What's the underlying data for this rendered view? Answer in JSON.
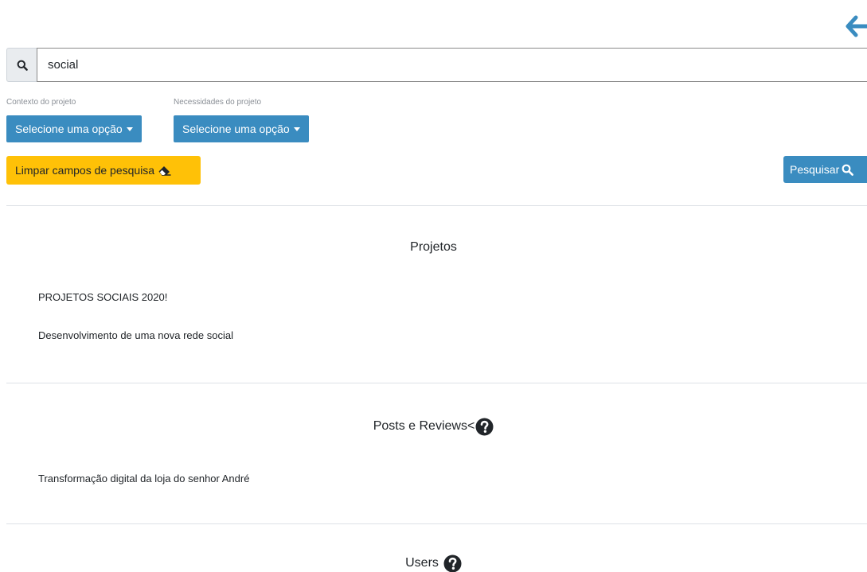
{
  "header": {
    "back_icon": "arrow-left-icon",
    "accent": "#3a8cc0"
  },
  "search": {
    "value": "social",
    "placeholder": "",
    "icon": "search-icon"
  },
  "filters": [
    {
      "label": "Contexto do projeto",
      "button": "Selecione uma opção"
    },
    {
      "label": "Necessidades do projeto",
      "button": "Selecione uma opção"
    }
  ],
  "actions": {
    "clear_label": "Limpar campos de pesquisa",
    "clear_icon": "eraser-icon",
    "clear_color": "#ffc107",
    "search_label": "Pesquisar",
    "search_icon": "search-icon"
  },
  "sections": {
    "projects": {
      "title": "Projetos",
      "items": [
        "PROJETOS SOCIAIS 2020!",
        "Desenvolvimento de uma nova rede social"
      ]
    },
    "posts": {
      "title": "Posts e Reviews<",
      "help_icon": "question-circle-icon",
      "items": [
        "Transformação digital da loja do senhor André"
      ]
    },
    "users": {
      "title": "Users",
      "help_icon": "question-circle-icon"
    }
  }
}
